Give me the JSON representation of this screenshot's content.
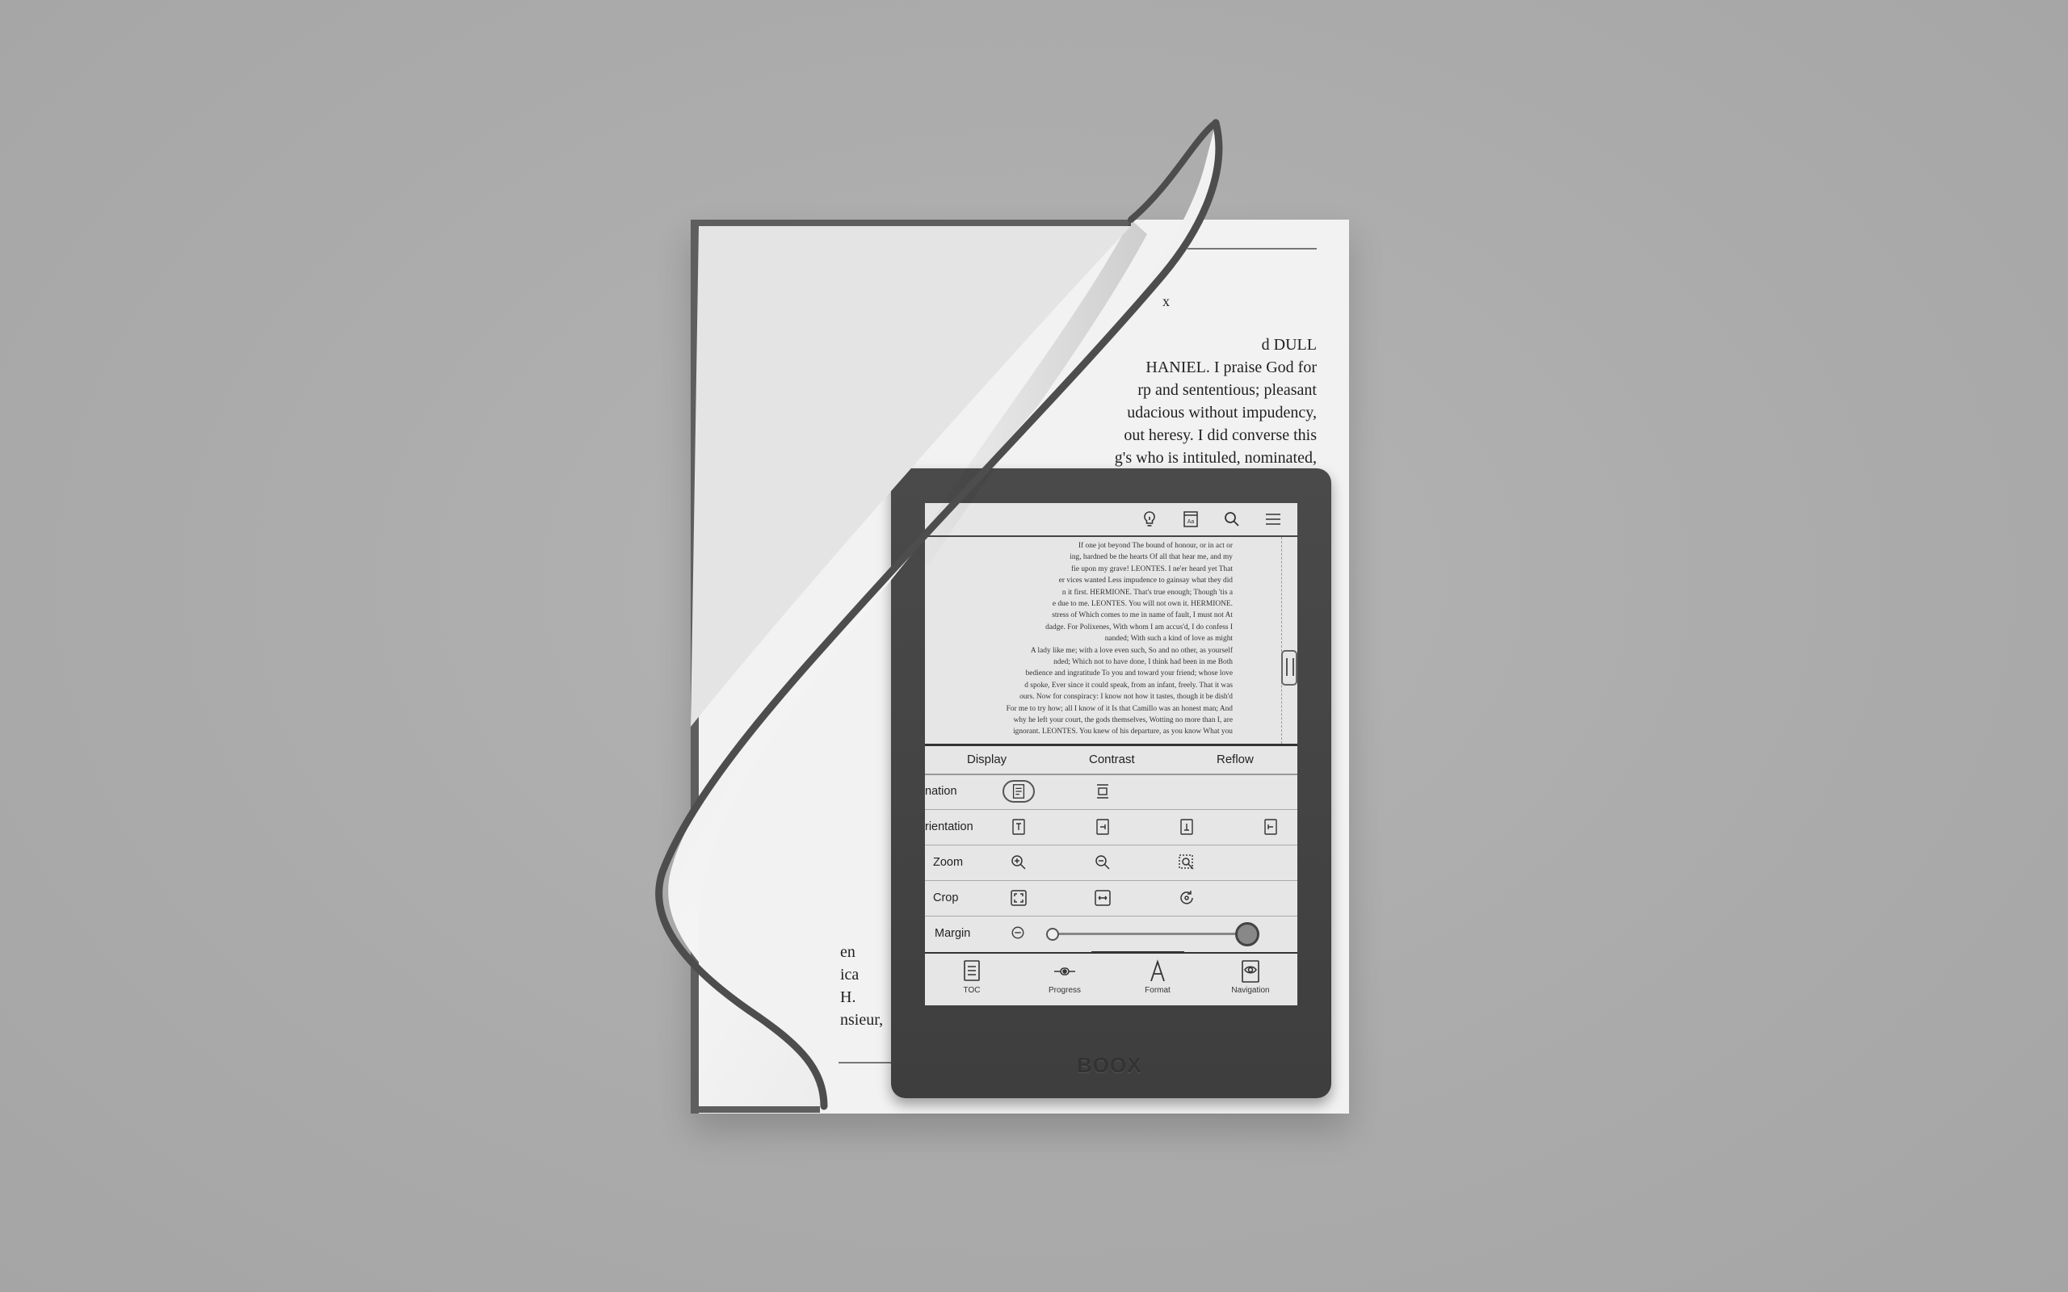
{
  "book": {
    "heading_mark": "x",
    "right_lines": [
      "d DULL",
      "HANIEL. I praise God for",
      "rp and sententious; pleasant",
      "udacious without impudency,",
      "out heresy. I did converse this",
      "g's who is intituled, nominated,"
    ],
    "left_lines": [
      "en",
      "ica",
      "H.",
      "nsieur,"
    ]
  },
  "device": {
    "logo": "BOOX",
    "reading_lines": [
      "If one jot beyond The bound of honour, or in act or",
      "ing, hardned be the hearts Of all that hear me, and my",
      "fie upon my grave! LEONTES. I ne'er heard yet That",
      "er vices wanted Less impudence to gainsay what they did",
      "n it first. HERMIONE. That's true enough; Though 'tis a",
      "e due to me. LEONTES. You will not own it. HERMIONE.",
      "stress of Which comes to me in name of fault, I must not At",
      "dadge. For Polixenes, With whom I am accus'd, I do confess I",
      "nanded; With such a kind of love as might",
      "A lady like me; with a love even such, So and no other, as yourself",
      "nded; Which not to have done, I think had been in me Both",
      "bedience and ingratitude To you and toward your friend; whose love",
      "d spoke, Ever since it could speak, from an infant, freely. That it was",
      "ours. Now for conspiracy: I know not how it tastes, though it be dish'd",
      "For me to try how; all I know of it Is that Camillo was an honest man; And",
      "why he left your court, the gods themselves, Wotting no more than I, are",
      "ignorant. LEONTES. You knew of his departure, as you know What you"
    ],
    "tabs": [
      "Display",
      "Contrast",
      "Reflow"
    ],
    "rows": [
      {
        "label": "nation"
      },
      {
        "label": "rientation"
      },
      {
        "label": "Zoom"
      },
      {
        "label": "Crop"
      },
      {
        "label": "Margin"
      }
    ],
    "margin_level": 0.94,
    "bottom_nav": [
      {
        "label": "TOC",
        "icon": "toc-icon"
      },
      {
        "label": "Progress",
        "icon": "progress-icon"
      },
      {
        "label": "Format",
        "icon": "format-icon"
      },
      {
        "label": "Navigation",
        "icon": "navigation-icon"
      }
    ],
    "toolbar_icons": [
      "lightbulb-icon",
      "font-settings-icon",
      "search-icon",
      "menu-icon"
    ]
  }
}
